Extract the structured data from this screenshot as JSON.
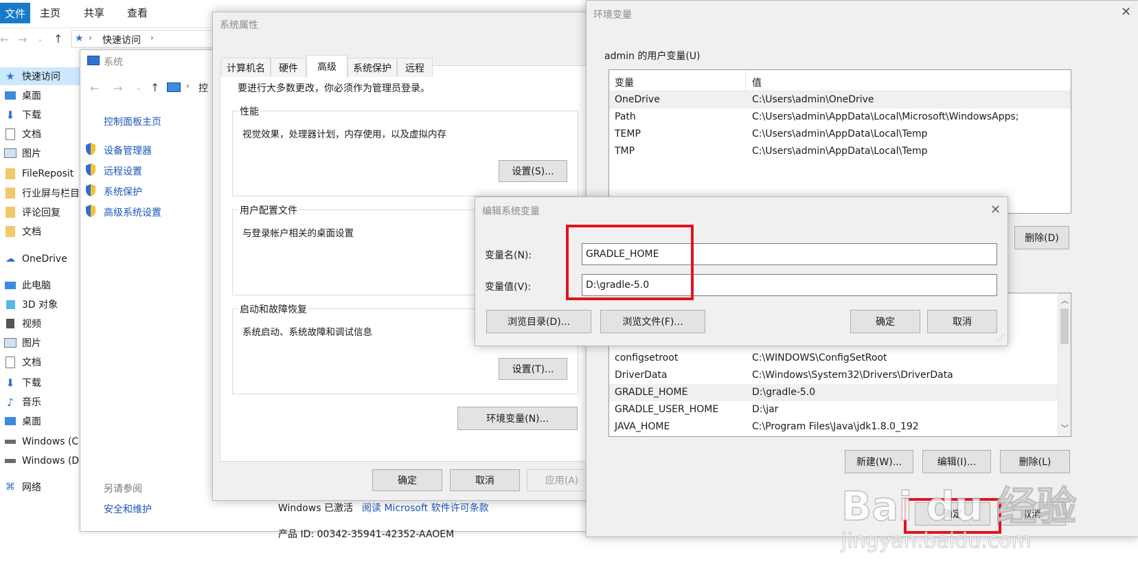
{
  "explorer": {
    "ribbon_tabs": [
      "文件",
      "主页",
      "共享",
      "查看"
    ],
    "breadcrumb": "快速访问",
    "nav_items": [
      {
        "label": "快速访问",
        "icon": "star-icon"
      },
      {
        "label": "桌面",
        "icon": "desktop-icon"
      },
      {
        "label": "下载",
        "icon": "download-icon"
      },
      {
        "label": "文档",
        "icon": "document-icon"
      },
      {
        "label": "图片",
        "icon": "picture-icon"
      },
      {
        "label": "FileReposit",
        "icon": "folder-icon"
      },
      {
        "label": "行业屏与栏目",
        "icon": "folder-icon"
      },
      {
        "label": "评论回复",
        "icon": "folder-icon"
      },
      {
        "label": "文档",
        "icon": "folder-icon"
      },
      {
        "label": "OneDrive",
        "icon": "cloud-icon"
      },
      {
        "label": "此电脑",
        "icon": "computer-icon"
      },
      {
        "label": "3D 对象",
        "icon": "cube-icon"
      },
      {
        "label": "视频",
        "icon": "video-icon"
      },
      {
        "label": "图片",
        "icon": "picture-icon"
      },
      {
        "label": "文档",
        "icon": "document-icon"
      },
      {
        "label": "下载",
        "icon": "download-icon"
      },
      {
        "label": "音乐",
        "icon": "music-icon"
      },
      {
        "label": "桌面",
        "icon": "desktop-icon"
      },
      {
        "label": "Windows (C",
        "icon": "drive-icon"
      },
      {
        "label": "Windows (D",
        "icon": "drive-icon"
      },
      {
        "label": "网络",
        "icon": "network-icon"
      }
    ]
  },
  "system_window": {
    "title": "系统",
    "breadcrumb": "控",
    "control_panel_home": "控制面板主页",
    "links": [
      "设备管理器",
      "远程设置",
      "系统保护",
      "高级系统设置"
    ],
    "see_also": "另请参阅",
    "security": "安全和维护",
    "activated_text": "Windows 已激活",
    "license_link": "阅读 Microsoft 软件许可条款",
    "product_id": "产品 ID: 00342-35941-42352-AAOEM"
  },
  "sys_props": {
    "title": "系统属性",
    "tabs": [
      "计算机名",
      "硬件",
      "高级",
      "系统保护",
      "远程"
    ],
    "admin_note": "要进行大多数更改，你必须作为管理员登录。",
    "perf_label": "性能",
    "perf_desc": "视觉效果，处理器计划，内存使用，以及虚拟内存",
    "perf_btn": "设置(S)...",
    "profile_label": "用户配置文件",
    "profile_desc": "与登录帐户相关的桌面设置",
    "startup_label": "启动和故障恢复",
    "startup_desc": "系统启动、系统故障和调试信息",
    "startup_btn": "设置(T)...",
    "env_btn": "环境变量(N)...",
    "ok": "确定",
    "cancel": "取消",
    "apply": "应用(A)"
  },
  "env_vars": {
    "title": "环境变量",
    "user_label": "admin 的用户变量(U)",
    "col_var": "变量",
    "col_val": "值",
    "user_rows": [
      {
        "name": "OneDrive",
        "value": "C:\\Users\\admin\\OneDrive"
      },
      {
        "name": "Path",
        "value": "C:\\Users\\admin\\AppData\\Local\\Microsoft\\WindowsApps;"
      },
      {
        "name": "TEMP",
        "value": "C:\\Users\\admin\\AppData\\Local\\Temp"
      },
      {
        "name": "TMP",
        "value": "C:\\Users\\admin\\AppData\\Local\\Temp"
      }
    ],
    "user_delete": "删除(D)",
    "sys_rows": [
      {
        "name": "configsetroot",
        "value": "C:\\WINDOWS\\ConfigSetRoot"
      },
      {
        "name": "DriverData",
        "value": "C:\\Windows\\System32\\Drivers\\DriverData"
      },
      {
        "name": "GRADLE_HOME",
        "value": "D:\\gradle-5.0"
      },
      {
        "name": "GRADLE_USER_HOME",
        "value": "D:\\jar"
      },
      {
        "name": "JAVA_HOME",
        "value": "C:\\Program Files\\Java\\jdk1.8.0_192"
      }
    ],
    "new_btn": "新建(W)...",
    "edit_btn": "编辑(I)...",
    "delete_btn": "删除(L)",
    "ok": "确定",
    "cancel": "取消"
  },
  "edit_dialog": {
    "title": "编辑系统变量",
    "name_label": "变量名(N):",
    "name_value": "GRADLE_HOME",
    "value_label": "变量值(V):",
    "value_value": "D:\\gradle-5.0",
    "browse_dir": "浏览目录(D)...",
    "browse_file": "浏览文件(F)...",
    "ok": "确定",
    "cancel": "取消"
  },
  "watermark": {
    "brand": "Bai du 经验",
    "url": "jingyan.baidu.com"
  },
  "colors": {
    "highlight_red": "#e0141e",
    "link_blue": "#1a56b8",
    "selection": "#e5f1fb",
    "row_hover": "#f0f0f0",
    "file_tab": "#1979ca"
  }
}
